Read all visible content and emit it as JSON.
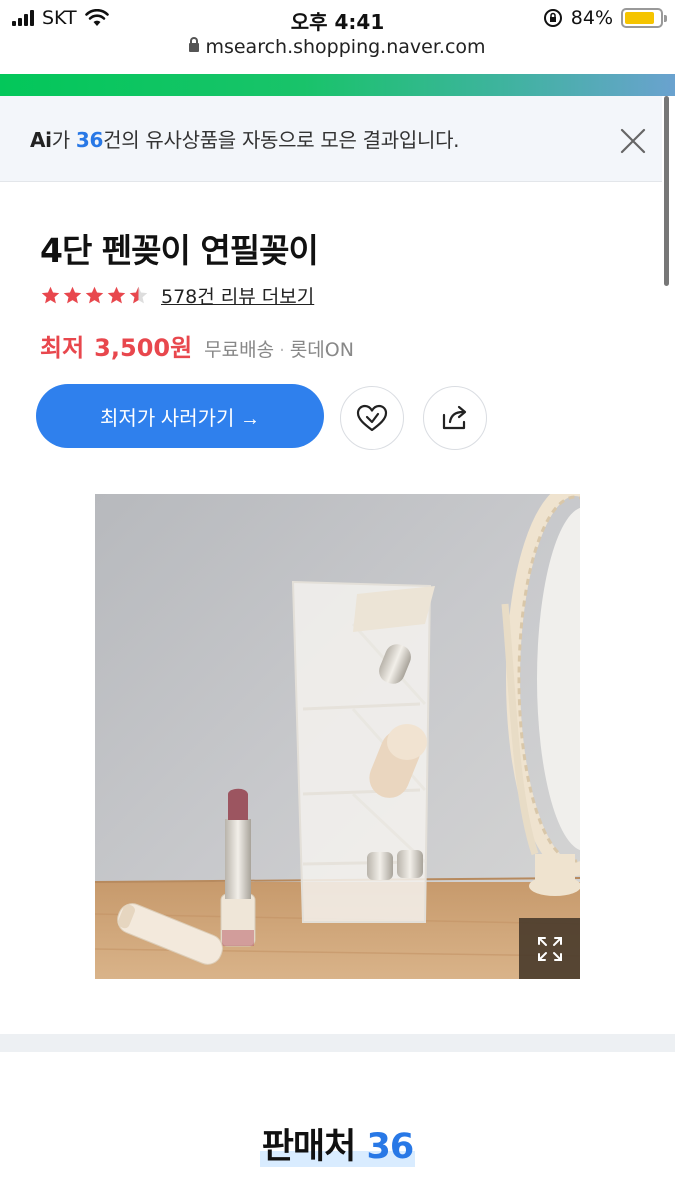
{
  "status_bar": {
    "carrier": "SKT",
    "time": "오후 4:41",
    "battery_text": "84%",
    "battery_level": 0.84
  },
  "url_bar": {
    "url": "msearch.shopping.naver.com"
  },
  "ai_banner": {
    "logo": "Ai",
    "text_before": "가 ",
    "count": "36",
    "text_after": "건의 유사상품을 자동으로 모은 결과입니다."
  },
  "product": {
    "title": "4단 펜꽂이 연필꽂이",
    "rating": 4.5,
    "review_link": "578건 리뷰 더보기",
    "price_label": "최저",
    "price": "3,500원",
    "shipping": "무료배송",
    "separator": "·",
    "mall": "롯데ON",
    "buy_button": "최저가 사러가기 →"
  },
  "icons": {
    "close": "close-icon",
    "heart": "heart-icon",
    "share": "share-icon",
    "expand": "expand-icon",
    "lock": "lock-icon",
    "wifi": "wifi-icon"
  },
  "colors": {
    "accent": "#2f80ed",
    "price": "#e8474d",
    "star": "#e8474d",
    "count": "#2878e6"
  },
  "sellers": {
    "label": "판매처",
    "count": "36"
  }
}
